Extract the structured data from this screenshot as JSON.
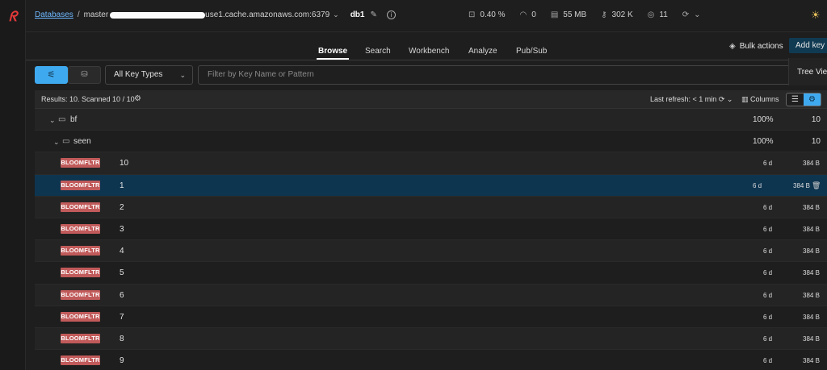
{
  "breadcrumb": {
    "databases": "Databases",
    "separator": "/",
    "host_prefix": "master",
    "host_suffix": "use1.cache.amazonaws.com:6379",
    "db": "db1"
  },
  "stats": {
    "cpu": "0.40 %",
    "ops": "0",
    "memory": "55 MB",
    "keys": "302 K",
    "clients": "11"
  },
  "tabs": [
    {
      "label": "Browse",
      "active": true
    },
    {
      "label": "Search"
    },
    {
      "label": "Workbench"
    },
    {
      "label": "Analyze"
    },
    {
      "label": "Pub/Sub"
    }
  ],
  "actions": {
    "bulk": "Bulk actions",
    "add_key": "Add key",
    "tree_view": "Tree View"
  },
  "filter": {
    "key_type": "All Key Types",
    "search_placeholder": "Filter by Key Name or Pattern"
  },
  "results": {
    "summary": "Results: 10. Scanned 10 / 10",
    "last_refresh_label": "Last refresh:",
    "last_refresh_value": "< 1 min",
    "columns": "Columns"
  },
  "folders": [
    {
      "name": "bf",
      "percent": "100%",
      "count": "10"
    },
    {
      "name": "seen",
      "percent": "100%",
      "count": "10"
    }
  ],
  "keys": [
    {
      "type": "BLOOMFLTR",
      "name": "10",
      "ttl": "6 d",
      "size": "384 B"
    },
    {
      "type": "BLOOMFLTR",
      "name": "1",
      "ttl": "6 d",
      "size": "384 B",
      "selected": true
    },
    {
      "type": "BLOOMFLTR",
      "name": "2",
      "ttl": "6 d",
      "size": "384 B"
    },
    {
      "type": "BLOOMFLTR",
      "name": "3",
      "ttl": "6 d",
      "size": "384 B"
    },
    {
      "type": "BLOOMFLTR",
      "name": "4",
      "ttl": "6 d",
      "size": "384 B"
    },
    {
      "type": "BLOOMFLTR",
      "name": "5",
      "ttl": "6 d",
      "size": "384 B"
    },
    {
      "type": "BLOOMFLTR",
      "name": "6",
      "ttl": "6 d",
      "size": "384 B"
    },
    {
      "type": "BLOOMFLTR",
      "name": "7",
      "ttl": "6 d",
      "size": "384 B"
    },
    {
      "type": "BLOOMFLTR",
      "name": "8",
      "ttl": "6 d",
      "size": "384 B"
    },
    {
      "type": "BLOOMFLTR",
      "name": "9",
      "ttl": "6 d",
      "size": "384 B"
    }
  ],
  "colors": {
    "accent": "#3fa9ef",
    "selected_row": "#0e3550",
    "badge": "#c15a5a",
    "link": "#6fb8ff"
  },
  "icons": {
    "logo": "redis-logo",
    "filter": "filter-icon",
    "scan": "scan-icon",
    "settings": "gear-icon",
    "refresh": "refresh-icon",
    "trash": "trash-icon",
    "folder": "folder-icon"
  }
}
